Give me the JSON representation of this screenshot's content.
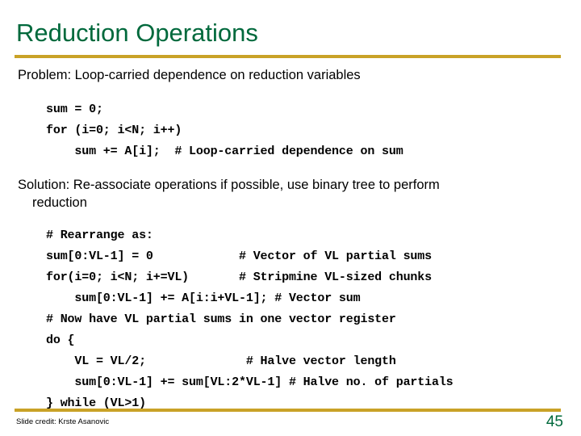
{
  "slide": {
    "title": "Reduction Operations",
    "accent_green": "#00693c",
    "accent_gold": "#c9a227",
    "problem_line": "Problem: Loop-carried dependence on reduction variables",
    "solution_line": "Solution: Re-associate operations if possible, use binary tree to perform",
    "solution_line_cont": "reduction",
    "code_block_1": "sum = 0;\nfor (i=0; i<N; i++)\n    sum += A[i];  # Loop-carried dependence on sum",
    "code_block_2": "# Rearrange as:\nsum[0:VL-1] = 0            # Vector of VL partial sums\nfor(i=0; i<N; i+=VL)       # Stripmine VL-sized chunks\n    sum[0:VL-1] += A[i:i+VL-1]; # Vector sum\n# Now have VL partial sums in one vector register\ndo {\n    VL = VL/2;              # Halve vector length\n    sum[0:VL-1] += sum[VL:2*VL-1] # Halve no. of partials\n} while (VL>1)",
    "footer_credit": "Slide credit: Krste Asanovic",
    "page_number": "45"
  }
}
